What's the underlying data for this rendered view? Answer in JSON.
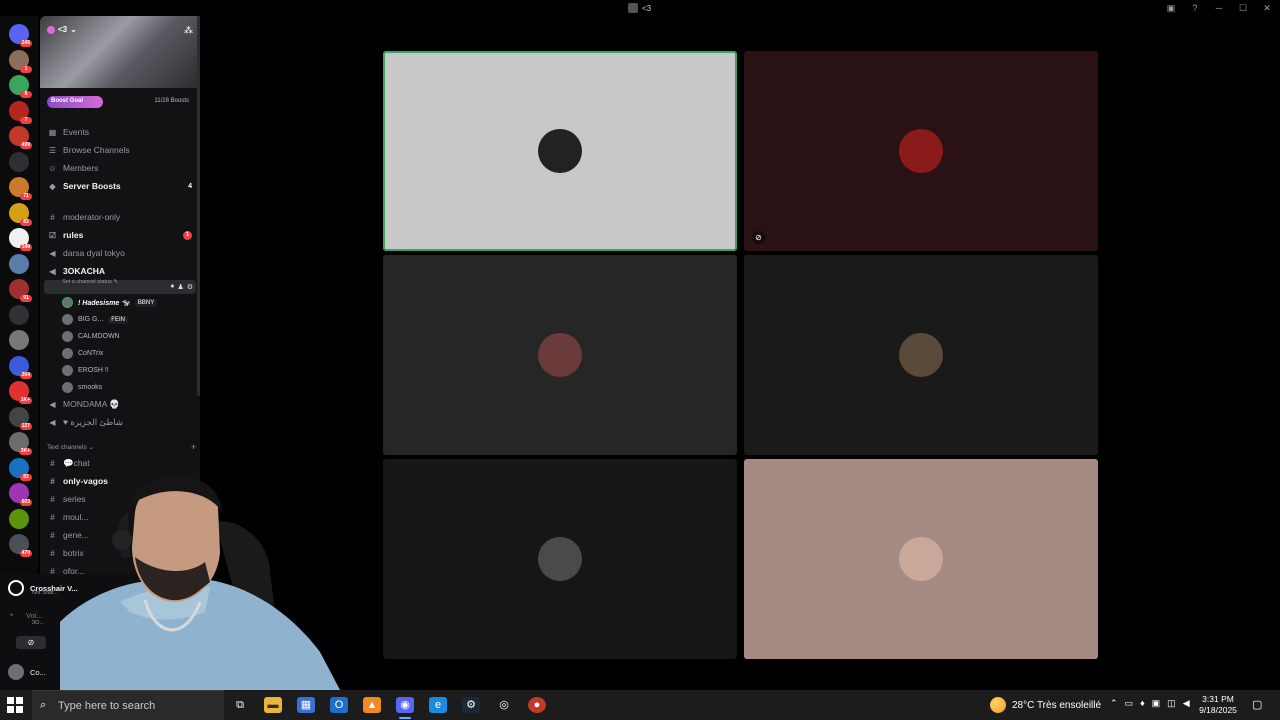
{
  "window": {
    "title": "<3",
    "controls": [
      "─",
      "☐",
      "✕"
    ]
  },
  "server_rail": {
    "servers": [
      {
        "name": "server-1",
        "badge": "245",
        "color": "#5865f2"
      },
      {
        "name": "server-2",
        "badge": "1",
        "color": "#8a6f5a"
      },
      {
        "name": "server-3",
        "badge": "6",
        "color": "#3ba55c"
      },
      {
        "name": "server-4",
        "badge": "7",
        "color": "#b3261e"
      },
      {
        "name": "server-5",
        "badge": "499",
        "color": "#c0392b"
      },
      {
        "name": "server-6",
        "badge": "",
        "color": "#2c2f33"
      },
      {
        "name": "server-7",
        "badge": "71",
        "color": "#c97b2b"
      },
      {
        "name": "server-8",
        "badge": "83",
        "color": "#d4a017"
      },
      {
        "name": "server-9",
        "badge": "149",
        "color": "#f0f0f0"
      },
      {
        "name": "server-10",
        "badge": "",
        "color": "#5b7ca8"
      },
      {
        "name": "server-11",
        "badge": "91",
        "color": "#a03030"
      },
      {
        "name": "server-12",
        "badge": "",
        "color": "#2f3136"
      },
      {
        "name": "server-13",
        "badge": "",
        "color": "#777"
      },
      {
        "name": "server-14",
        "badge": "264",
        "color": "#3b5bdb"
      },
      {
        "name": "server-15",
        "badge": "1K+",
        "color": "#e03131"
      },
      {
        "name": "server-16",
        "badge": "127",
        "color": "#444"
      },
      {
        "name": "server-17",
        "badge": "2K+",
        "color": "#6c6c6c"
      },
      {
        "name": "server-18",
        "badge": "82",
        "color": "#1971c2"
      },
      {
        "name": "server-19",
        "badge": "603",
        "color": "#9c36b5"
      },
      {
        "name": "server-20",
        "badge": "",
        "color": "#5c940d"
      },
      {
        "name": "server-21",
        "badge": "470",
        "color": "#495057"
      }
    ]
  },
  "server": {
    "name": "<3",
    "boost_goal": "Boost Goal",
    "boost_count": "11/28 Boosts",
    "menu": [
      {
        "label": "Events",
        "icon": "calendar-icon",
        "bold": false,
        "count": ""
      },
      {
        "label": "Browse Channels",
        "icon": "browse-icon",
        "bold": false,
        "count": ""
      },
      {
        "label": "Members",
        "icon": "members-icon",
        "bold": false,
        "count": ""
      },
      {
        "label": "Server Boosts",
        "icon": "boost-icon",
        "bold": true,
        "count": "4"
      }
    ],
    "channels": [
      {
        "label": "moderator-only",
        "icon": "#",
        "bold": false,
        "badge": ""
      },
      {
        "label": "rules",
        "icon": "☑",
        "bold": true,
        "badge": "1"
      },
      {
        "label": "darsa dyal tokyo",
        "icon": "🔊",
        "bold": false,
        "badge": ""
      }
    ],
    "active_voice": {
      "label": "3OKACHA",
      "status": "Set a channel status ✎"
    },
    "voice_users": [
      {
        "name": "! Hadesisme 🐄",
        "tag": "BBNY"
      },
      {
        "name": "BIG G...",
        "tag": "FEIN"
      },
      {
        "name": "CALMDOWN",
        "tag": ""
      },
      {
        "name": "CoNTrix",
        "tag": ""
      },
      {
        "name": "EROSH !!",
        "tag": ""
      },
      {
        "name": "smooks",
        "tag": ""
      }
    ],
    "other_voice": [
      {
        "label": "MONDAMA 💀"
      },
      {
        "label": "♥ شاطئ الجزيرة"
      }
    ],
    "text_section": "Text channels",
    "text_channels": [
      "💬chat",
      "only-vagos",
      "series",
      "moul...",
      "gene...",
      "botrix",
      "ofor..."
    ]
  },
  "user_area": {
    "app": "Crosshair V...",
    "app_sub": "Not Shar...",
    "voice_label": "Voi...",
    "voice_sub": "3O...",
    "user": "Co..."
  },
  "call_grid": {
    "tiles": [
      {
        "name": "tile-1",
        "bg": "#c8c8c8",
        "avatar": "#222",
        "speaking": true,
        "muted": false
      },
      {
        "name": "tile-2",
        "bg": "#2a1214",
        "avatar": "#8b1a1a",
        "speaking": false,
        "muted": true
      },
      {
        "name": "tile-3",
        "bg": "#262626",
        "avatar": "#6b3a3a",
        "speaking": false,
        "muted": false
      },
      {
        "name": "tile-4",
        "bg": "#1a1a18",
        "avatar": "#5a4a3a",
        "speaking": false,
        "muted": false
      },
      {
        "name": "tile-5",
        "bg": "#161616",
        "avatar": "#4a4a4a",
        "speaking": false,
        "muted": false
      },
      {
        "name": "tile-6",
        "bg": "#a68a84",
        "avatar": "#c9a89a",
        "speaking": false,
        "muted": false
      }
    ],
    "speaking_color": "#3ba55c"
  },
  "taskbar": {
    "search_placeholder": "Type here to search",
    "weather": "28°C  Très ensoleillé",
    "time": "3:31 PM",
    "date": "9/18/2025"
  }
}
